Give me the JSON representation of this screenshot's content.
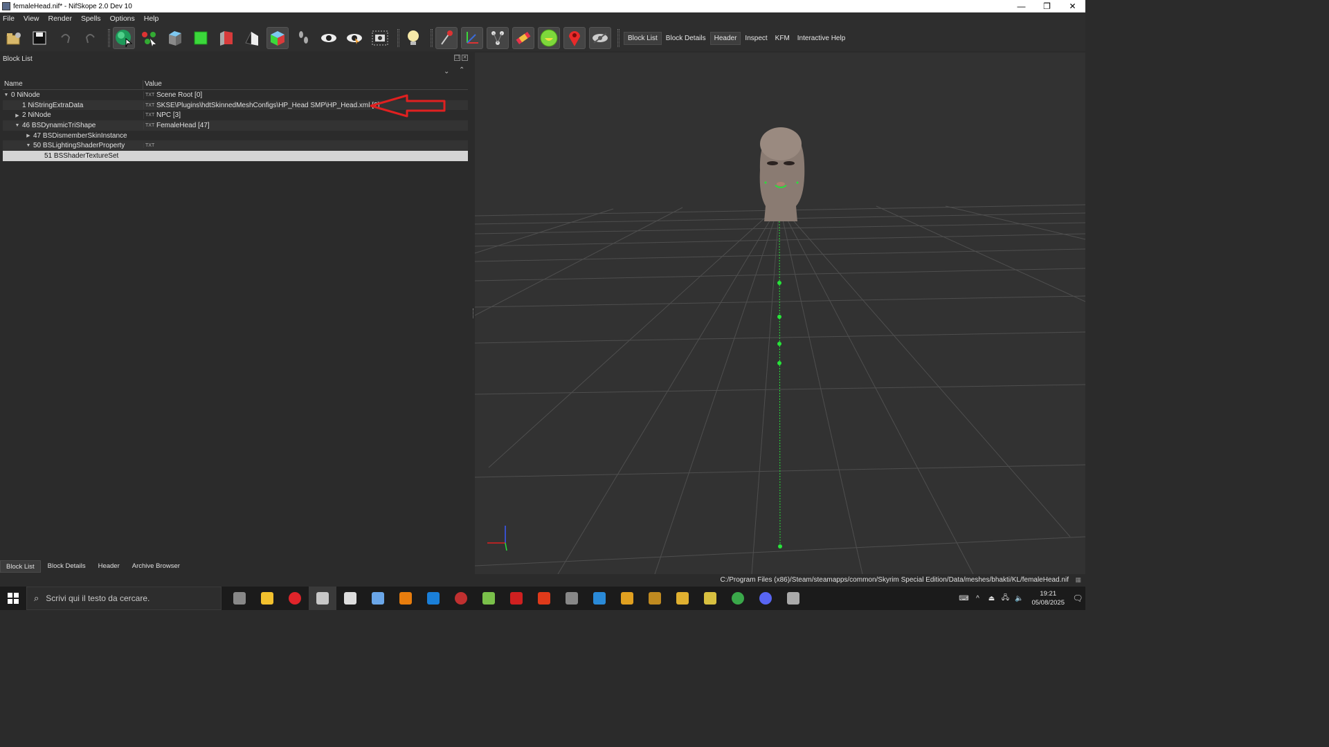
{
  "window": {
    "title": "femaleHead.nif* - NifSkope 2.0 Dev 10",
    "controls": [
      "—",
      "❐",
      "✕"
    ]
  },
  "menu": [
    "File",
    "View",
    "Render",
    "Spells",
    "Options",
    "Help"
  ],
  "toolbar": {
    "icons": [
      "open-icon",
      "save-icon",
      "undo-icon",
      "redo-icon",
      "select-icon",
      "connect-icon",
      "view-top-icon",
      "view-front-icon",
      "view-side-icon",
      "view-flip-icon",
      "view-user-icon",
      "walk-icon",
      "visibility-icon",
      "visibility-alt-icon",
      "screenshot-icon",
      "light-icon",
      "node-icon",
      "axes-icon",
      "constraints-icon",
      "havok-icon",
      "furniture-icon",
      "marker-icon",
      "hidden-icon"
    ],
    "tabs": [
      "Block List",
      "Block Details",
      "Header",
      "Inspect",
      "KFM",
      "Interactive Help"
    ],
    "active_tabs": [
      "Block List",
      "Header"
    ]
  },
  "block_list": {
    "title": "Block List",
    "columns": [
      "Name",
      "Value"
    ],
    "rows": [
      {
        "name": "0 NiNode",
        "value": "Scene Root [0]",
        "indent": 0,
        "arrow": "▼",
        "has_icon": true
      },
      {
        "name": "1 NiStringExtraData",
        "value": "SKSE\\Plugins\\hdtSkinnedMeshConfigs\\HP_Head SMP\\HP_Head.xml [2]",
        "indent": 1,
        "arrow": "",
        "has_icon": true
      },
      {
        "name": "2 NiNode",
        "value": "NPC [3]",
        "indent": 1,
        "arrow": "▶",
        "has_icon": true
      },
      {
        "name": "46 BSDynamicTriShape",
        "value": "FemaleHead [47]",
        "indent": 1,
        "arrow": "▼",
        "has_icon": true
      },
      {
        "name": "47 BSDismemberSkinInstance",
        "value": "",
        "indent": 2,
        "arrow": "▶",
        "has_icon": false
      },
      {
        "name": "50 BSLightingShaderProperty",
        "value": "",
        "indent": 2,
        "arrow": "▼",
        "has_icon": true
      },
      {
        "name": "51 BSShaderTextureSet",
        "value": "",
        "indent": 3,
        "arrow": "",
        "has_icon": false
      }
    ],
    "selected_row": 6,
    "annotation_color": "#e02020"
  },
  "bottom_tabs": [
    "Block List",
    "Block Details",
    "Header",
    "Archive Browser"
  ],
  "bottom_active": "Block List",
  "status": {
    "path": "C:/Program Files (x86)/Steam/steamapps/common/Skyrim Special Edition/Data/meshes/bhakti/KL/femaleHead.nif"
  },
  "taskbar": {
    "search_placeholder": "Scrivi qui il testo da cercare.",
    "apps": [
      "task-view-icon",
      "file-explorer-icon",
      "opera-icon",
      "nifskope-icon",
      "mo2-icon",
      "quill-icon",
      "blender-icon",
      "store-icon",
      "game-icon",
      "notes-icon",
      "flash-icon",
      "foxit-icon",
      "terminal-icon",
      "mail-icon",
      "folder-icon",
      "spellbook-icon",
      "archive-icon",
      "map-icon",
      "chrome-icon",
      "discord-icon",
      "nif-icon"
    ],
    "active_app": 3,
    "time": "19:21",
    "date": "05/08/2025"
  },
  "colors": {
    "bone_green": "#27e43a",
    "selection_row": "#d4d4d4"
  }
}
